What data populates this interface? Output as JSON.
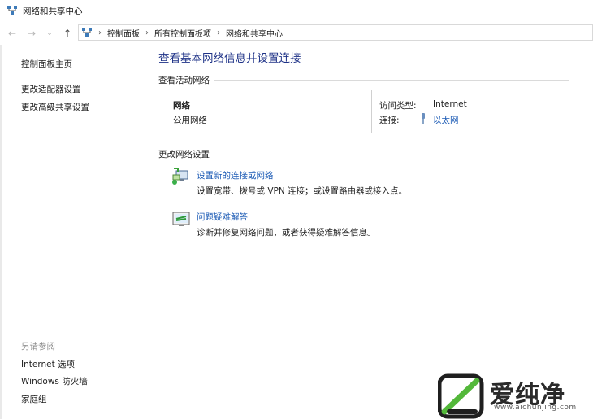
{
  "window": {
    "title": "网络和共享中心"
  },
  "nav": {
    "breadcrumbs": [
      "控制面板",
      "所有控制面板项",
      "网络和共享中心"
    ]
  },
  "sidebar": {
    "home": "控制面板主页",
    "links": [
      "更改适配器设置",
      "更改高级共享设置"
    ],
    "see_also_label": "另请参阅",
    "see_also": [
      "Internet 选项",
      "Windows 防火墙",
      "家庭组"
    ]
  },
  "main": {
    "title": "查看基本网络信息并设置连接",
    "active_networks_label": "查看活动网络",
    "network": {
      "name": "网络",
      "category": "公用网络",
      "access_type_label": "访问类型:",
      "access_type": "Internet",
      "connections_label": "连接:",
      "connection": "以太网"
    },
    "change_settings_label": "更改网络设置",
    "tasks": [
      {
        "title": "设置新的连接或网络",
        "desc": "设置宽带、拨号或 VPN 连接；或设置路由器或接入点。",
        "icon": "network-setup-icon"
      },
      {
        "title": "问题疑难解答",
        "desc": "诊断并修复网络问题，或者获得疑难解答信息。",
        "icon": "troubleshoot-icon"
      }
    ]
  },
  "watermark": {
    "text": "爱纯净",
    "url": "www.aichunjing.com"
  }
}
